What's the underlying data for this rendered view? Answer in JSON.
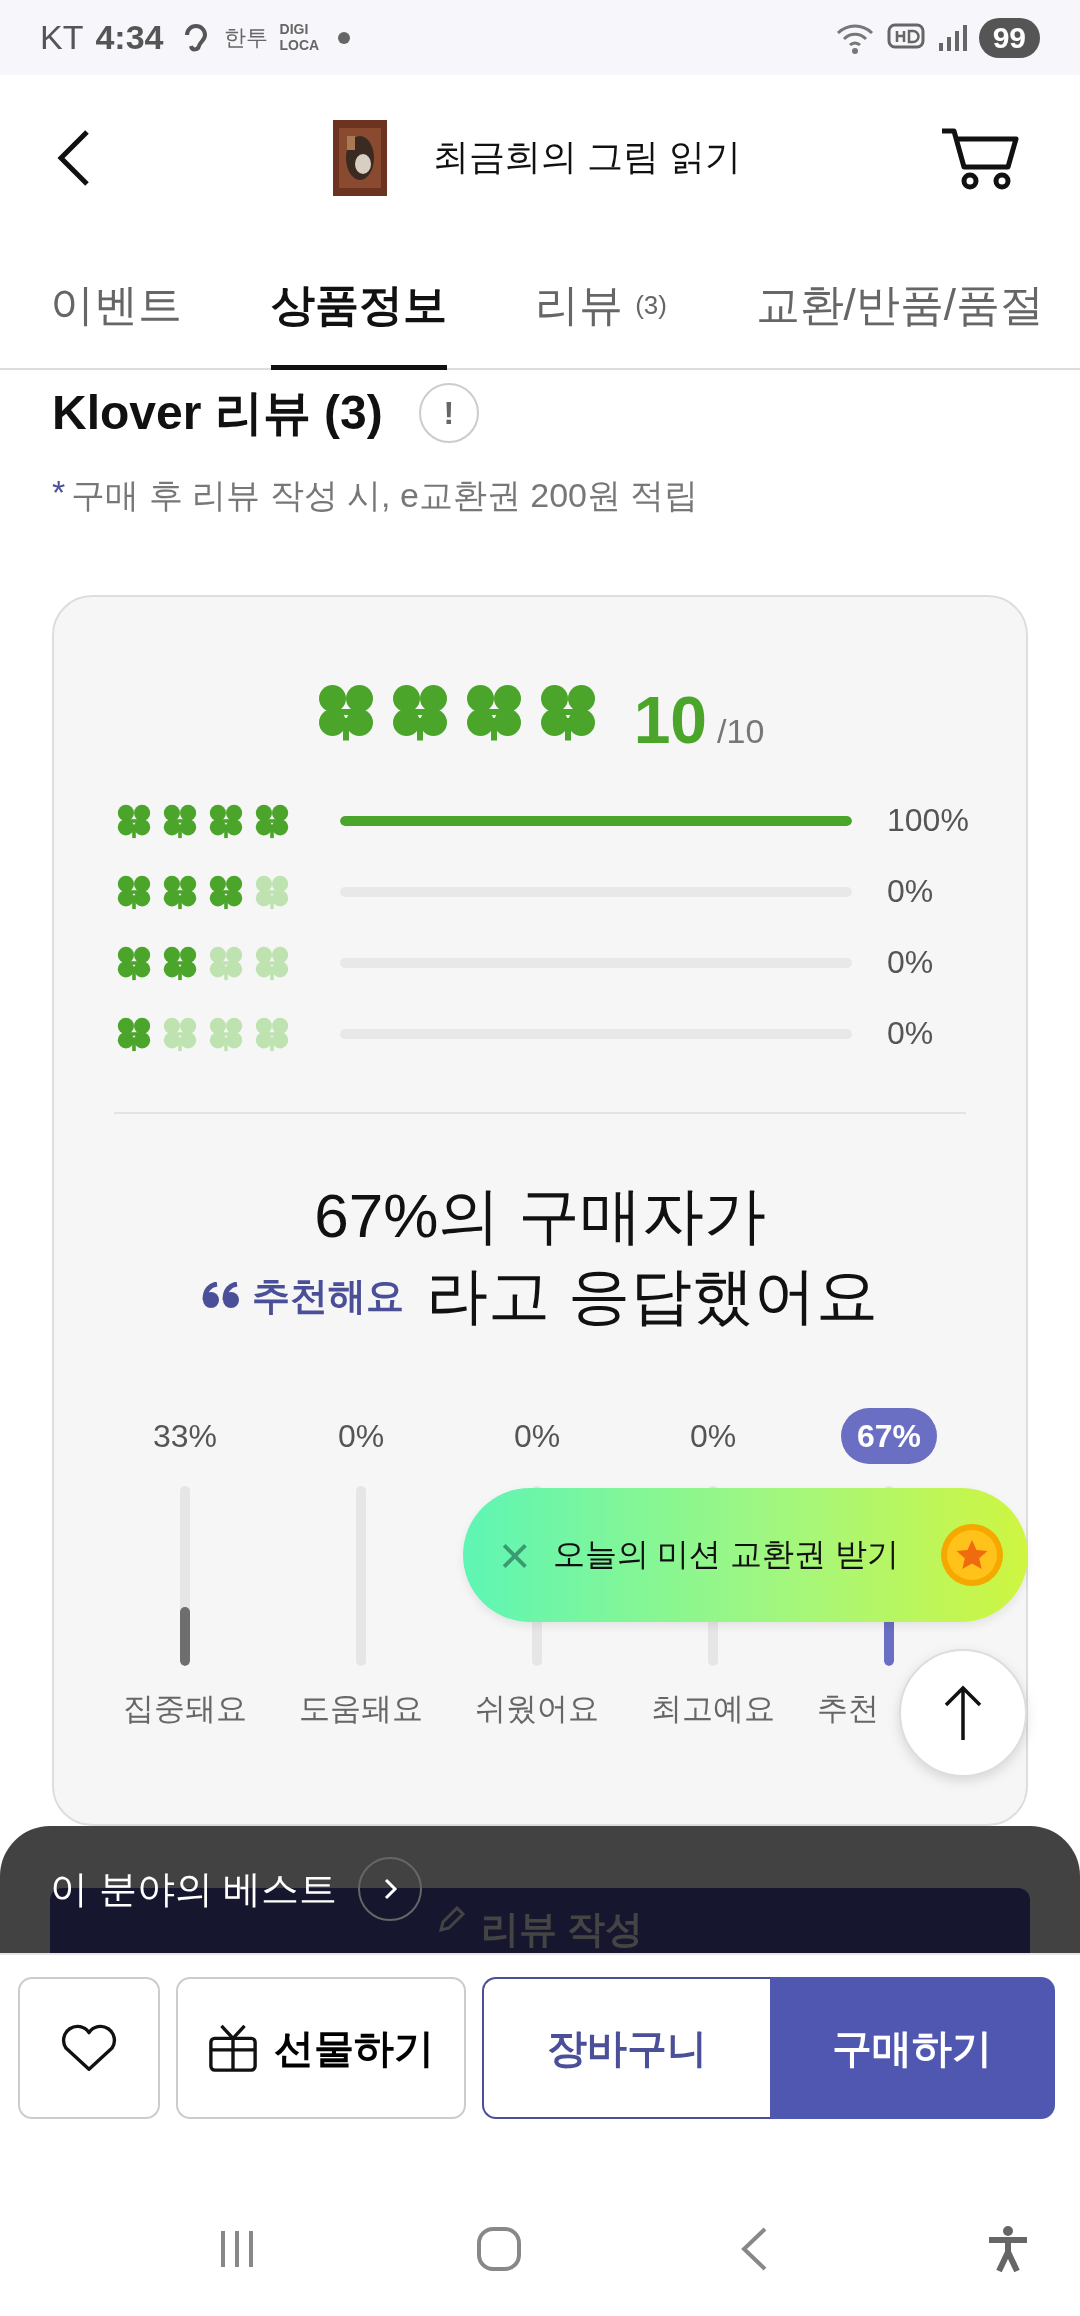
{
  "status_bar": {
    "carrier": "KT",
    "time": "4:34",
    "notifications": [
      "한투",
      "DIGI LOCA"
    ],
    "battery": "99"
  },
  "header": {
    "title": "최금희의 그림 읽기"
  },
  "tabs": [
    {
      "label": "이벤트",
      "selected": false
    },
    {
      "label": "상품정보",
      "selected": true
    },
    {
      "label": "리뷰",
      "count": "(3)",
      "selected": false
    },
    {
      "label": "교환/반품/품절",
      "selected": false
    }
  ],
  "review_section": {
    "title": "Klover 리뷰 (3)",
    "info": "!",
    "note_mark": "*",
    "note": "구매 후 리뷰 작성 시, e교환권 200원 적립",
    "summary": {
      "stars": 4,
      "score": "10",
      "max": "/10"
    },
    "distribution": [
      {
        "stars": 4,
        "level": 1,
        "percent": "100%"
      },
      {
        "stars": 3,
        "level": 0,
        "percent": "0%"
      },
      {
        "stars": 2,
        "level": 0,
        "percent": "0%"
      },
      {
        "stars": 1,
        "level": 0,
        "percent": "0%"
      }
    ],
    "recommend": {
      "line1": "67%의 구매자가",
      "tag": "추천해요",
      "line2": "라고 응답했어요"
    },
    "keywords": [
      {
        "label": "집중돼요",
        "percent": "33%",
        "level": 0.33,
        "selected": false
      },
      {
        "label": "도움돼요",
        "percent": "0%",
        "level": 0,
        "selected": false
      },
      {
        "label": "쉬웠어요",
        "percent": "0%",
        "level": 0,
        "selected": false
      },
      {
        "label": "최고예요",
        "percent": "0%",
        "level": 0,
        "selected": false
      },
      {
        "label": "추천",
        "percent": "67%",
        "level": 0.67,
        "selected": true
      }
    ]
  },
  "mission_popup": {
    "close": "×",
    "text": "오늘의 미션 교환권 받기"
  },
  "best_sheet": {
    "title": "이 분야의 베스트",
    "behind_button": "리뷰 작성"
  },
  "action_bar": {
    "gift": "선물하기",
    "cart": "장바구니",
    "buy": "구매하기"
  }
}
